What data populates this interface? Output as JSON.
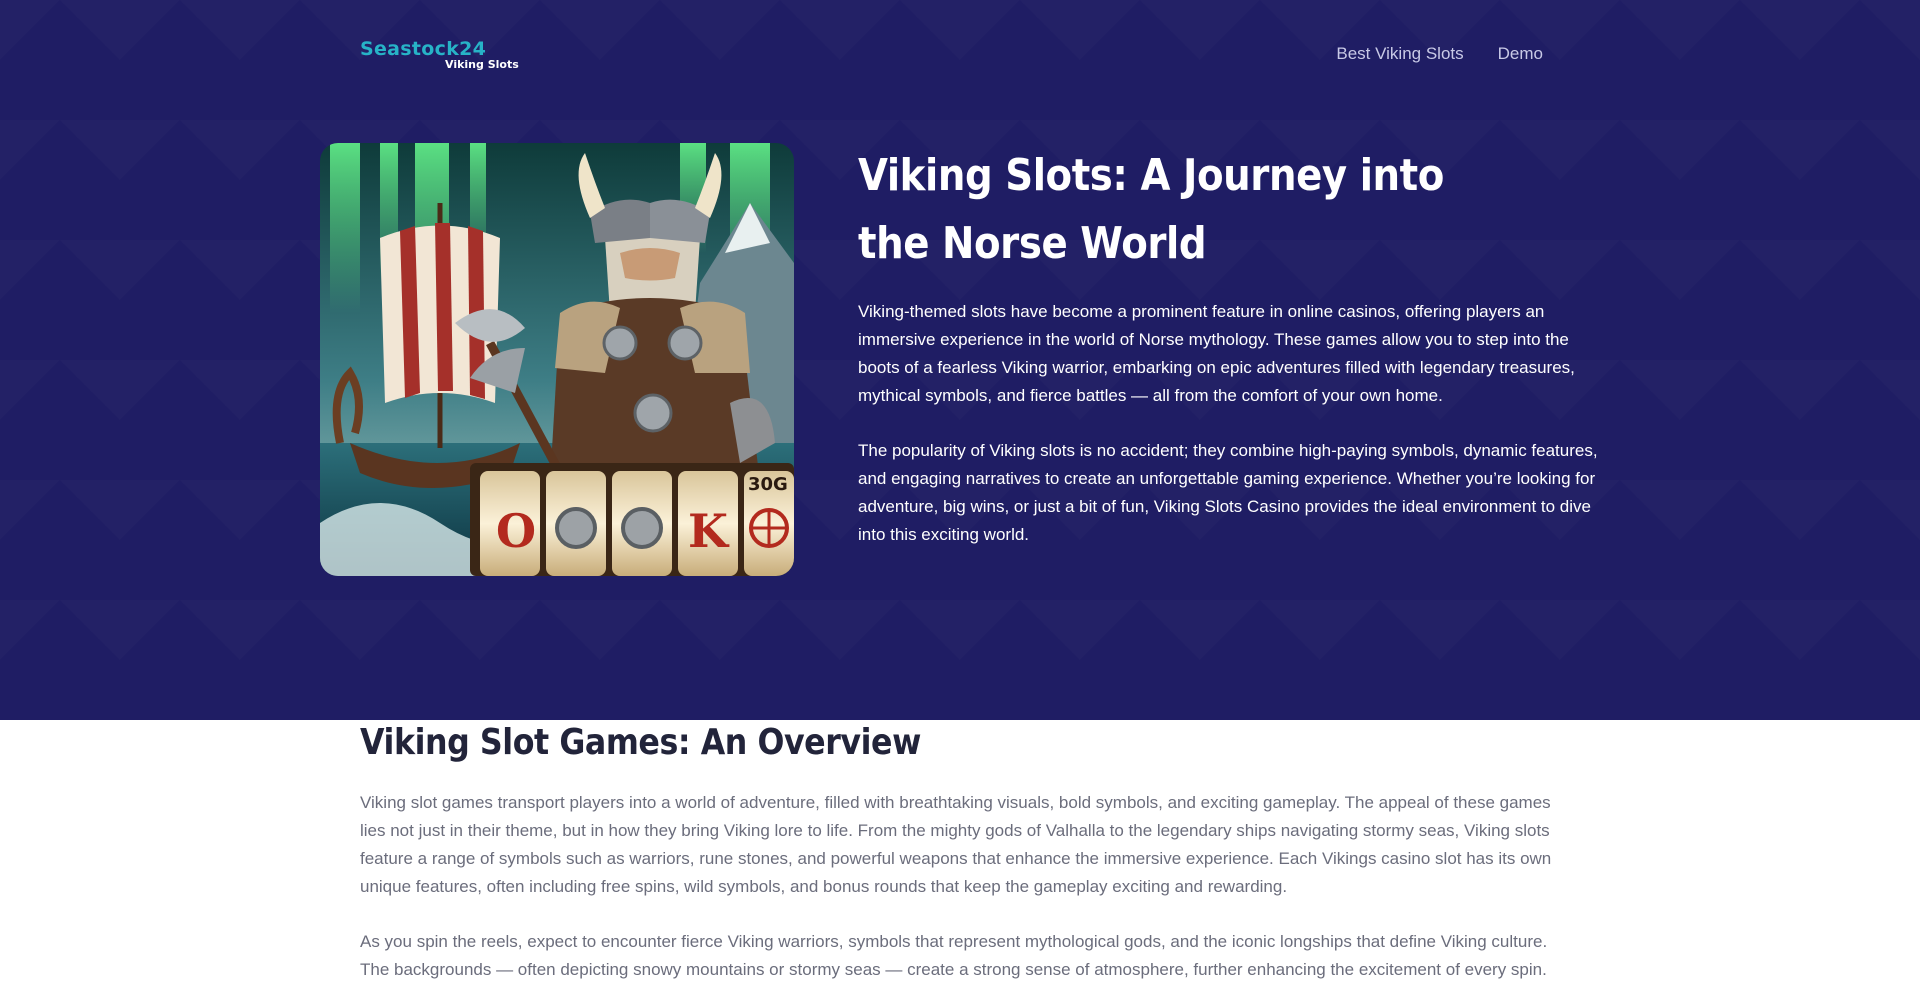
{
  "header": {
    "logo_main": "Seastock24",
    "logo_sub": "Viking Slots",
    "nav": [
      "Best Viking Slots",
      "Demo"
    ]
  },
  "hero": {
    "title": "Viking Slots: A Journey into the Norse World",
    "paragraphs": [
      "Viking-themed slots have become a prominent feature in online casinos, offering players an immersive experience in the world of Norse mythology. These games allow you to step into the boots of a fearless Viking warrior, embarking on epic adventures filled with legendary treasures, mythical symbols, and fierce battles — all from the comfort of your own home.",
      "The popularity of Viking slots is no accident; they combine high-paying symbols, dynamic features, and engaging narratives to create an unforgettable gaming experience. Whether you’re looking for adventure, big wins, or just a bit of fun, Viking Slots Casino provides the ideal environment to dive into this exciting world."
    ],
    "image": {
      "reel_symbols": [
        "O",
        "K"
      ],
      "reel_top_label": "30G"
    }
  },
  "overview": {
    "title": "Viking Slot Games: An Overview",
    "paragraphs": [
      "Viking slot games transport players into a world of adventure, filled with breathtaking visuals, bold symbols, and exciting gameplay. The appeal of these games lies not just in their theme, but in how they bring Viking lore to life. From the mighty gods of Valhalla to the legendary ships navigating stormy seas, Viking slots feature a range of symbols such as warriors, rune stones, and powerful weapons that enhance the immersive experience. Each Vikings casino slot has its own unique features, often including free spins, wild symbols, and bonus rounds that keep the gameplay exciting and rewarding.",
      "As you spin the reels, expect to encounter fierce Viking warriors, symbols that represent mythological gods, and the iconic longships that define Viking culture. The backgrounds — often depicting snowy mountains or stormy seas — create a strong sense of atmosphere, further enhancing the excitement of every spin."
    ]
  },
  "colors": {
    "hero_bg": "#1f1d64",
    "logo_accent": "#27b3c7",
    "overview_title": "#22243a",
    "overview_text": "#6b6d7c"
  }
}
